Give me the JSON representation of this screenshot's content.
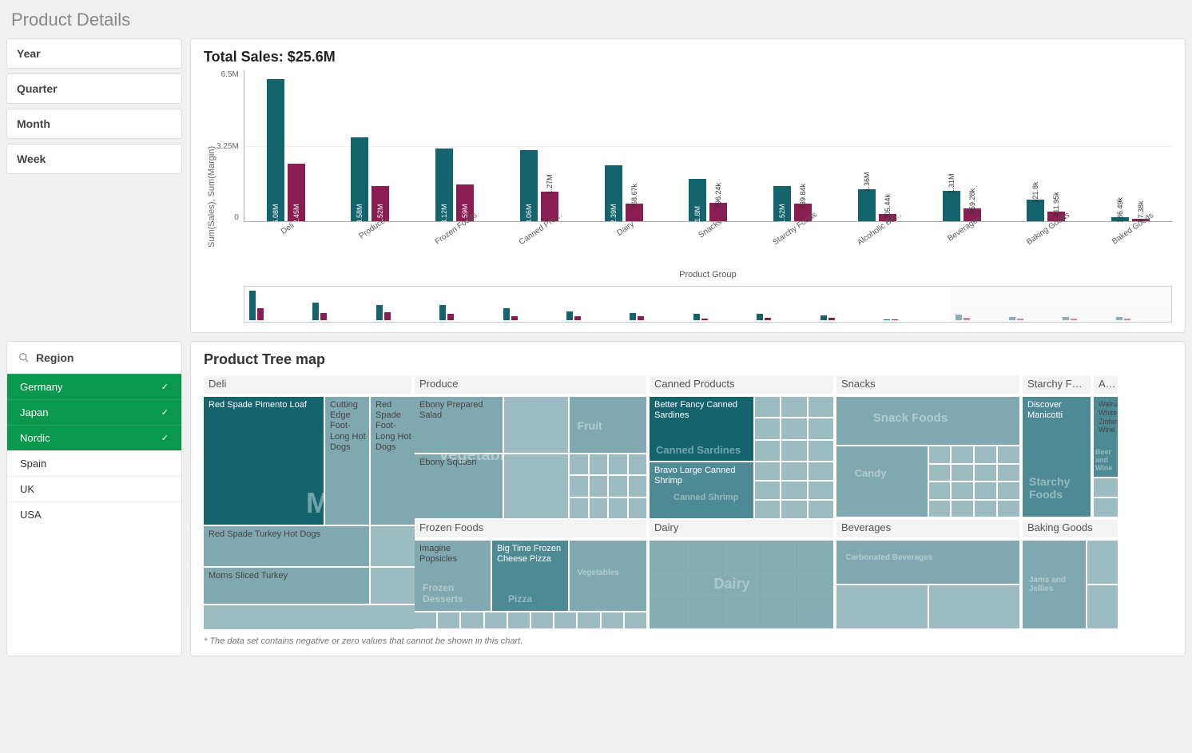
{
  "page_title": "Product Details",
  "filters": {
    "year": "Year",
    "quarter": "Quarter",
    "month": "Month",
    "week": "Week"
  },
  "region_panel": {
    "label": "Region",
    "items": [
      {
        "name": "Germany",
        "selected": true
      },
      {
        "name": "Japan",
        "selected": true
      },
      {
        "name": "Nordic",
        "selected": true
      },
      {
        "name": "Spain",
        "selected": false
      },
      {
        "name": "UK",
        "selected": false
      },
      {
        "name": "USA",
        "selected": false
      }
    ]
  },
  "total_sales_title": "Total Sales: $25.6M",
  "chart_data": {
    "type": "bar",
    "title": "Total Sales: $25.6M",
    "ylabel": "Sum(Sales), Sum(Margin)",
    "xlabel": "Product Group",
    "ylim": [
      0,
      6500000
    ],
    "yticks": [
      "6.5M",
      "3.25M",
      "0"
    ],
    "categories": [
      "Deli",
      "Produce",
      "Frozen Foods",
      "Canned Pro…",
      "Dairy",
      "Snacks",
      "Starchy Foods",
      "Alcoholic Be…",
      "Beverages",
      "Baking Goods",
      "Baked Goods"
    ],
    "series": [
      {
        "name": "Sum(Sales)",
        "color": "#14646e",
        "values": [
          6080000,
          3580000,
          3120000,
          3060000,
          2390000,
          1800000,
          1520000,
          1360000,
          1310000,
          921800,
          186490
        ],
        "labels": [
          "6.08M",
          "3.58M",
          "3.12M",
          "3.06M",
          "2.39M",
          "1.8M",
          "1.52M",
          "1.36M",
          "1.31M",
          "921.8k",
          "186.49k"
        ]
      },
      {
        "name": "Sum(Margin)",
        "color": "#8a1e52",
        "values": [
          2450000,
          1520000,
          1590000,
          1270000,
          768670,
          796240,
          739840,
          305440,
          559280,
          411950,
          97380
        ],
        "labels": [
          "2.45M",
          "1.52M",
          "1.59M",
          "1.27M",
          "768.67k",
          "796.24k",
          "739.84k",
          "305.44k",
          "559.28k",
          "411.95k",
          "97.38k"
        ]
      }
    ]
  },
  "treemap": {
    "title": "Product Tree map",
    "footnote": "* The data set contains negative or zero values that cannot be shown in this chart.",
    "groups": {
      "deli": {
        "header": "Deli",
        "ghost": "Meat",
        "items": [
          "Red Spade Pimento Loaf",
          "Cutting Edge Foot-Long Hot Dogs",
          "Red Spade Foot-Long Hot Dogs",
          "Red Spade Turkey Hot Dogs",
          "Moms Sliced Turkey"
        ]
      },
      "produce": {
        "header": "Produce",
        "ghosts": [
          "Vegetables",
          "Fruit"
        ],
        "items": [
          "Ebony Prepared Salad",
          "Ebony Squash"
        ]
      },
      "frozen": {
        "header": "Frozen Foods",
        "ghosts": [
          "Frozen Desserts",
          "Pizza",
          "Vegetables"
        ],
        "items": [
          "Imagine Popsicles",
          "Big Time Frozen Cheese Pizza"
        ]
      },
      "canned": {
        "header": "Canned Products",
        "ghosts": [
          "Canned Sardines",
          "Canned Shrimp"
        ],
        "items": [
          "Better Fancy Canned Sardines",
          "Bravo Large Canned Shrimp"
        ]
      },
      "dairy": {
        "header": "Dairy",
        "ghost": "Dairy"
      },
      "snacks": {
        "header": "Snacks",
        "ghosts": [
          "Snack Foods",
          "Candy"
        ]
      },
      "beverages": {
        "header": "Beverages",
        "ghost": "Carbonated Beverages"
      },
      "starchy": {
        "header": "Starchy Fo…",
        "ghost": "Starchy Foods",
        "items": [
          "Discover Manicotti"
        ]
      },
      "baking": {
        "header": "Baking Goods",
        "ghost": "Jams and Jellies"
      },
      "alcoholic": {
        "header": "Alcoholic…",
        "ghost": "Beer and Wine",
        "items": [
          "Walrus White Zinfandel Wine"
        ]
      }
    }
  }
}
